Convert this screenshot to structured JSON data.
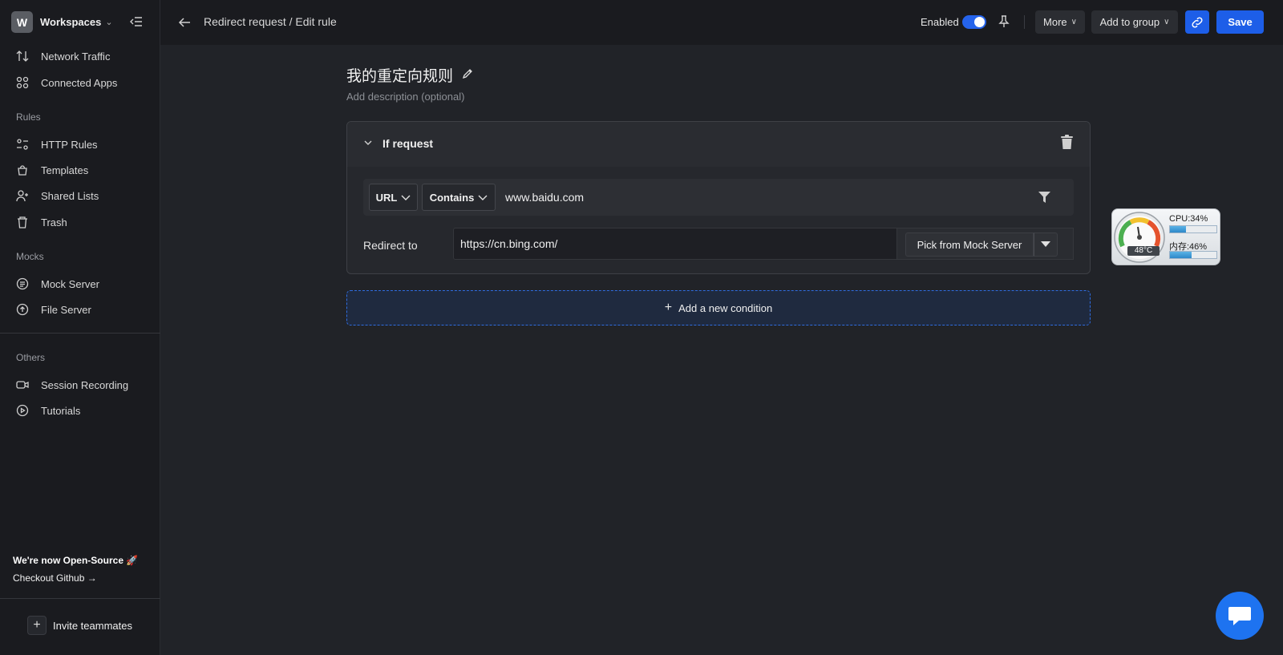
{
  "workspace": {
    "initial": "W",
    "name": "Workspaces"
  },
  "sidebar": {
    "items": [
      {
        "label": "Network Traffic",
        "icon": "arrows-up-down-icon"
      },
      {
        "label": "Connected Apps",
        "icon": "grid-icon"
      }
    ],
    "rules_section": "Rules",
    "rules_items": [
      {
        "label": "HTTP Rules",
        "icon": "rules-icon"
      },
      {
        "label": "Templates",
        "icon": "bag-icon"
      },
      {
        "label": "Shared Lists",
        "icon": "user-plus-icon"
      },
      {
        "label": "Trash",
        "icon": "trash-icon"
      }
    ],
    "mocks_section": "Mocks",
    "mocks_items": [
      {
        "label": "Mock Server",
        "icon": "document-icon"
      },
      {
        "label": "File Server",
        "icon": "upload-icon"
      }
    ],
    "others_section": "Others",
    "others_items": [
      {
        "label": "Session Recording",
        "icon": "video-icon"
      },
      {
        "label": "Tutorials",
        "icon": "play-icon"
      }
    ],
    "oss_title": "We're now Open-Source 🚀",
    "oss_link": "Checkout Github →",
    "invite": "Invite teammates"
  },
  "topbar": {
    "breadcrumb": "Redirect request / Edit rule",
    "enabled_label": "Enabled",
    "enabled": true,
    "more": "More",
    "add_to_group": "Add to group",
    "save": "Save"
  },
  "rule": {
    "title": "我的重定向规则",
    "description_placeholder": "Add description (optional)",
    "condition_header": "If request",
    "source_key": "URL",
    "operator": "Contains",
    "source_value": "www.baidu.com",
    "redirect_label": "Redirect to",
    "redirect_value": "https://cn.bing.com/",
    "pick_button": "Pick from Mock Server",
    "add_condition": "Add a new condition"
  },
  "widget": {
    "cpu": "CPU:34%",
    "cpu_pct": 34,
    "mem": "内存:46%",
    "mem_pct": 46,
    "temp": "48°C"
  },
  "colors": {
    "accent": "#1d5ee8",
    "bg": "#212328",
    "sidebar": "#1a1b1f"
  }
}
